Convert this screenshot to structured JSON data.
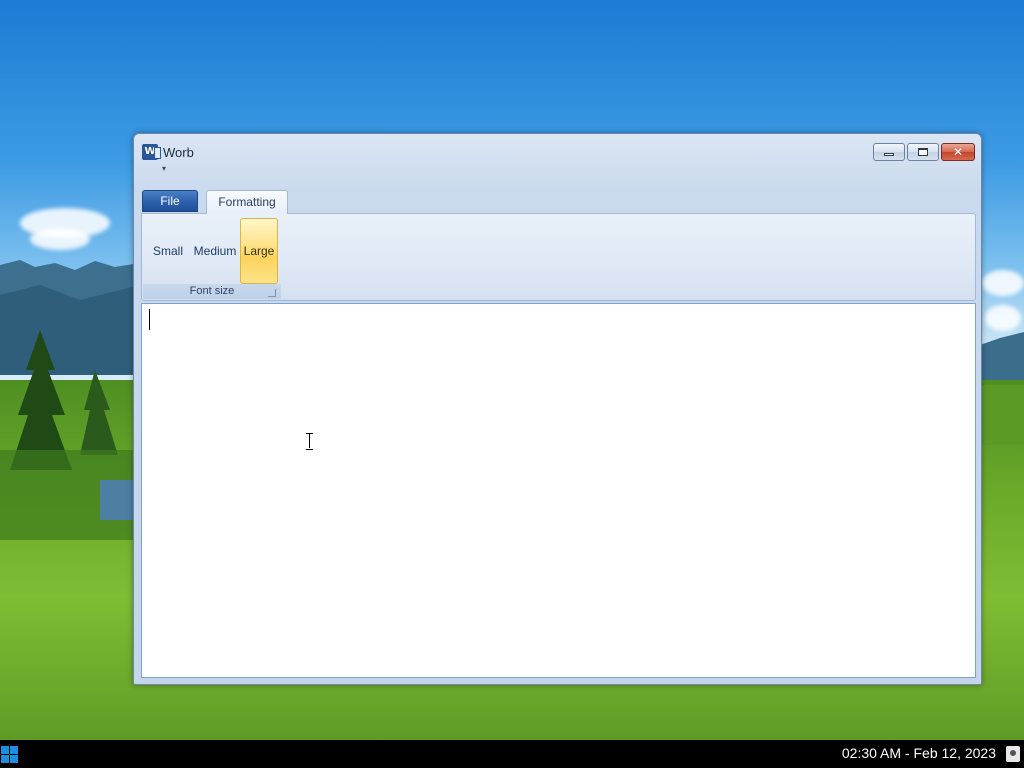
{
  "window": {
    "title": "Worb",
    "icon": "word-app-icon",
    "controls": [
      "minimize-icon",
      "maximize-icon",
      "close-icon"
    ]
  },
  "ribbon": {
    "tabs": [
      {
        "label": "File"
      },
      {
        "label": "Formatting",
        "active": true
      }
    ],
    "font_size_group": {
      "label": "Font size",
      "buttons": [
        {
          "label": "Small"
        },
        {
          "label": "Medium"
        },
        {
          "label": "Large",
          "selected": true
        }
      ]
    }
  },
  "document": {
    "text": ""
  },
  "taskbar": {
    "clock": "02:30 AM - Feb 12, 2023"
  },
  "colors": {
    "file_tab": "#2f63ad",
    "selected_button": "#fbd35a",
    "taskbar": "#000000",
    "start_icon": "#1d8fe3"
  }
}
